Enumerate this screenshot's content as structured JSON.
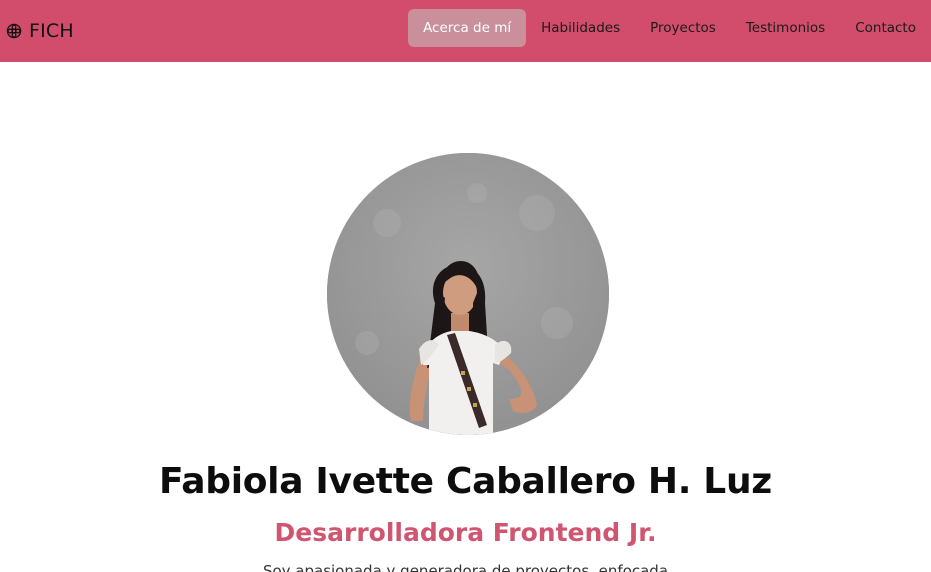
{
  "colors": {
    "navbar_bg": "#d24d6c",
    "active_tab_bg": "#c9909c",
    "role_text": "#cf5570"
  },
  "brand": {
    "icon": "flower-icon",
    "text": "FICH"
  },
  "nav": {
    "items": [
      {
        "label": "Acerca de mí",
        "active": true
      },
      {
        "label": "Habilidades",
        "active": false
      },
      {
        "label": "Proyectos",
        "active": false
      },
      {
        "label": "Testimonios",
        "active": false
      },
      {
        "label": "Contacto",
        "active": false
      }
    ]
  },
  "hero": {
    "name": "Fabiola Ivette Caballero H. Luz",
    "role": "Desarrolladora Frontend Jr.",
    "bio_partial": "Soy apasionada y generadora de proyectos, enfocada"
  }
}
